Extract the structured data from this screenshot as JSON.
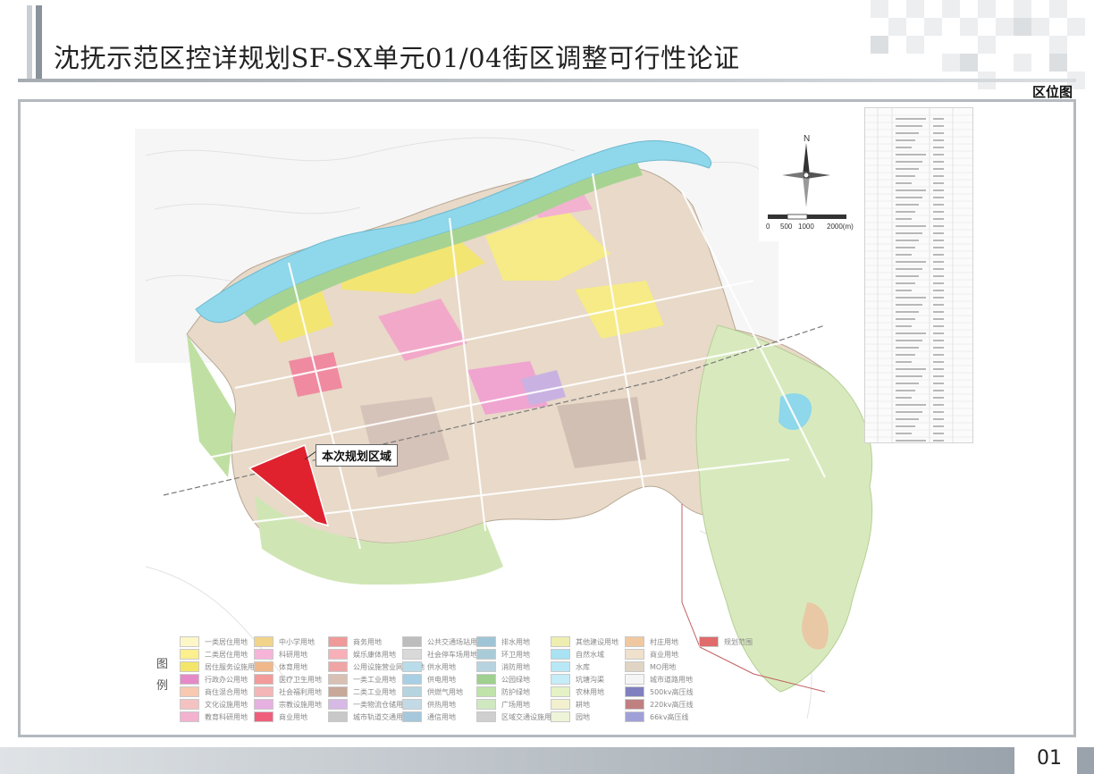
{
  "header": {
    "title": "沈抚示范区控详规划SF-SX单元01/04街区调整可行性论证",
    "subtitle": "区位图"
  },
  "map": {
    "callout_label": "本次规划区域",
    "compass_letter": "N",
    "scale_labels": [
      "0",
      "500",
      "1000",
      "2000(m)"
    ],
    "legend_heading": [
      "图",
      "例"
    ],
    "legend": [
      {
        "label": "一类居住用地",
        "color": "#fdf7c8"
      },
      {
        "label": "二类居住用地",
        "color": "#fbef8e"
      },
      {
        "label": "居住服务设施用地",
        "color": "#f3e56a"
      },
      {
        "label": "行政办公用地",
        "color": "#e58ac8"
      },
      {
        "label": "商住混合用地",
        "color": "#f7c9b0"
      },
      {
        "label": "文化设施用地",
        "color": "#f5c2c2"
      },
      {
        "label": "教育科研用地",
        "color": "#f2b2d0"
      },
      {
        "label": "中小学用地",
        "color": "#f1d48a"
      },
      {
        "label": "科研用地",
        "color": "#f7b4d9"
      },
      {
        "label": "体育用地",
        "color": "#f0b88a"
      },
      {
        "label": "医疗卫生用地",
        "color": "#f39a9a"
      },
      {
        "label": "社会福利用地",
        "color": "#f4b6b6"
      },
      {
        "label": "宗教设施用地",
        "color": "#e6b0e0"
      },
      {
        "label": "商业用地",
        "color": "#ef5f7c"
      },
      {
        "label": "商务用地",
        "color": "#ee9a9a"
      },
      {
        "label": "娱乐康体用地",
        "color": "#f8b0b8"
      },
      {
        "label": "公用设施营业网点用地",
        "color": "#f0a5a5"
      },
      {
        "label": "一类工业用地",
        "color": "#d8c0b5"
      },
      {
        "label": "二类工业用地",
        "color": "#c8a898"
      },
      {
        "label": "一类物流仓储用地",
        "color": "#d7b9e6"
      },
      {
        "label": "城市轨道交通用地",
        "color": "#c8c8c8"
      },
      {
        "label": "公共交通场站用地",
        "color": "#bdbdbd"
      },
      {
        "label": "社会停车场用地",
        "color": "#d9d9d9"
      },
      {
        "label": "供水用地",
        "color": "#b9dcea"
      },
      {
        "label": "供电用地",
        "color": "#a8cfe3"
      },
      {
        "label": "供燃气用地",
        "color": "#b6d4e0"
      },
      {
        "label": "供热用地",
        "color": "#c2dae6"
      },
      {
        "label": "通信用地",
        "color": "#a5c8dc"
      },
      {
        "label": "排水用地",
        "color": "#9fc4d6"
      },
      {
        "label": "环卫用地",
        "color": "#a9cbd8"
      },
      {
        "label": "消防用地",
        "color": "#b7d3df"
      },
      {
        "label": "公园绿地",
        "color": "#9fd08f"
      },
      {
        "label": "防护绿地",
        "color": "#bfe3a9"
      },
      {
        "label": "广场用地",
        "color": "#d0e8c0"
      },
      {
        "label": "区域交通设施用地",
        "color": "#cfcfcf"
      },
      {
        "label": "其他建设用地",
        "color": "#eeeeb0"
      },
      {
        "label": "自然水域",
        "color": "#a9e2f2"
      },
      {
        "label": "水库",
        "color": "#b8e8f5"
      },
      {
        "label": "坑塘沟渠",
        "color": "#c6ecf7"
      },
      {
        "label": "农林用地",
        "color": "#e4f2c6"
      },
      {
        "label": "耕地",
        "color": "#f2f0cf"
      },
      {
        "label": "园地",
        "color": "#eef4d8"
      },
      {
        "label": "村庄用地",
        "color": "#f0c8a0"
      },
      {
        "label": "商业用地",
        "color": "#efe1cb"
      },
      {
        "label": "MO用地",
        "color": "#e0d4c4"
      },
      {
        "label": "城市道路用地",
        "color": "#f5f5f5"
      },
      {
        "label": "500kv高压线",
        "color": "#8080c0"
      },
      {
        "label": "220kv高压线",
        "color": "#c08080"
      },
      {
        "label": "66kv高压线",
        "color": "#a0a0d8"
      },
      {
        "label": "规划范围",
        "color": "#e06b6b"
      }
    ]
  },
  "footer": {
    "page_number": "01"
  }
}
